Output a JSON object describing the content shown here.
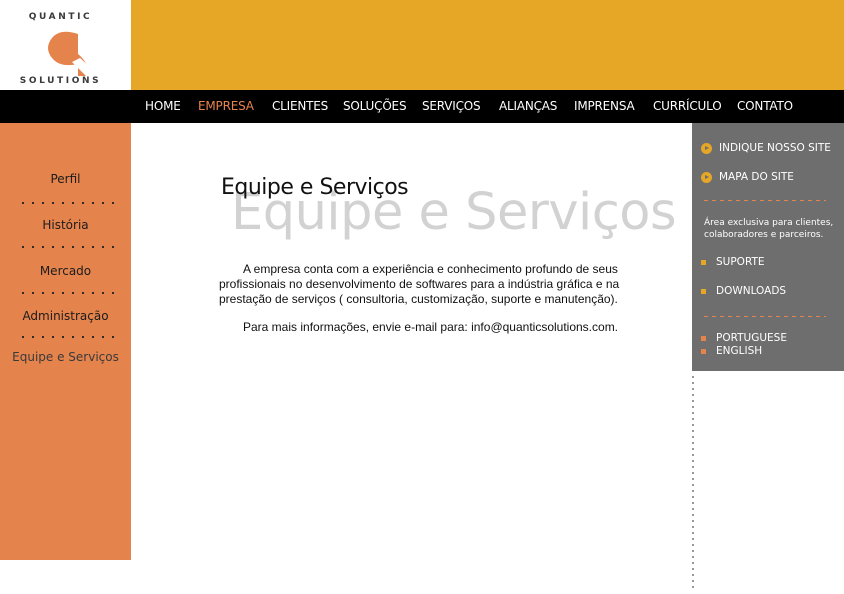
{
  "logo": {
    "top_text": "QUANTIC",
    "bottom_text": "SOLUTIONS"
  },
  "nav": {
    "items": [
      "HOME",
      "EMPRESA",
      "CLIENTES",
      "SOLUÇÕES",
      "SERVIÇOS",
      "ALIANÇAS",
      "IMPRENSA",
      "CURRÍCULO",
      "CONTATO"
    ],
    "active": "EMPRESA"
  },
  "sidebar": {
    "items": [
      "Perfil",
      "História",
      "Mercado",
      "Administração",
      "Equipe e Serviços"
    ],
    "active": "Equipe e Serviços"
  },
  "main": {
    "title": "Equipe e Serviços",
    "title_background": "Equipe e Serviços",
    "paragraph1": "A empresa conta com a experiência e conhecimento profundo de seus profissionais no desenvolvimento de softwares para a indústria gráfica e na prestação de serviços ( consultoria, customização, suporte e manutenção).",
    "paragraph2": "Para mais informações, envie e-mail para: info@quanticsolutions.com."
  },
  "right_panel": {
    "indique": "INDIQUE NOSSO SITE",
    "mapa": "MAPA DO SITE",
    "exclusive_text": "Área exclusiva para clientes, colaboradores e parceiros.",
    "suporte": "SUPORTE",
    "downloads": "DOWNLOADS",
    "portuguese": "PORTUGUESE",
    "english": "ENGLISH"
  },
  "colors": {
    "header_yellow": "#e6a626",
    "sidebar_orange": "#e5834c",
    "nav_black": "#000000",
    "panel_gray": "#6e6e6e",
    "active_nav": "#e8844c"
  }
}
